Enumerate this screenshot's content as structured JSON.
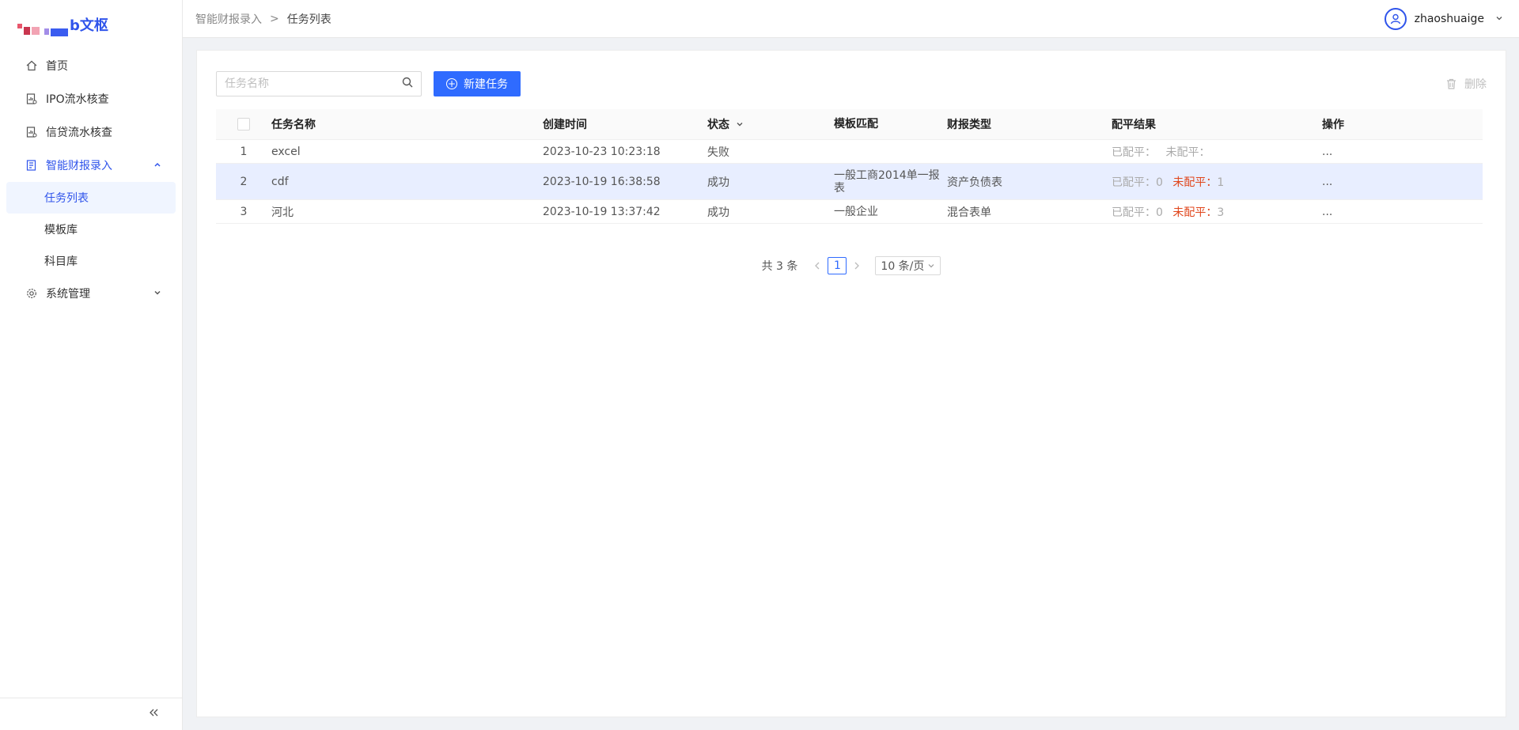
{
  "sidebar": {
    "logo_text": "b文枢",
    "menu": [
      {
        "label": "首页",
        "icon": "home-icon"
      },
      {
        "label": "IPO流水核查",
        "icon": "document-chart-icon"
      },
      {
        "label": "信贷流水核查",
        "icon": "document-chart-icon"
      },
      {
        "label": "智能财报录入",
        "icon": "report-icon"
      },
      {
        "label": "系统管理",
        "icon": "gear-icon"
      }
    ],
    "submenu": [
      "任务列表",
      "模板库",
      "科目库"
    ],
    "collapse_icon": "double-chevron-left-icon"
  },
  "header": {
    "breadcrumb": [
      "智能财报录入",
      "任务列表"
    ],
    "breadcrumb_separator": ">",
    "username": "zhaoshuaige"
  },
  "toolbar": {
    "search_placeholder": "任务名称",
    "new_task_label": "新建任务",
    "delete_label": "删除"
  },
  "table": {
    "columns": [
      "任务名称",
      "创建时间",
      "状态",
      "模板匹配",
      "财报类型",
      "配平结果",
      "操作"
    ],
    "rows": [
      {
        "index": "1",
        "name": "excel",
        "created": "2023-10-23 10:23:18",
        "status": "失败",
        "template": "",
        "type": "",
        "balanced_label": "已配平：",
        "balanced": "",
        "unbalanced_label": "未配平：",
        "unbalanced": "",
        "op": "..."
      },
      {
        "index": "2",
        "name": "cdf",
        "created": "2023-10-19 16:38:58",
        "status": "成功",
        "template": "一般工商2014单一报表",
        "type": "资产负债表",
        "balanced_label": "已配平：",
        "balanced": "0",
        "unbalanced_label": "未配平：",
        "unbalanced": "1",
        "op": "..."
      },
      {
        "index": "3",
        "name": "河北",
        "created": "2023-10-19 13:37:42",
        "status": "成功",
        "template": "一般企业",
        "type": "混合表单",
        "balanced_label": "已配平：",
        "balanced": "0",
        "unbalanced_label": "未配平：",
        "unbalanced": "3",
        "op": "..."
      }
    ]
  },
  "pagination": {
    "total_text": "共 3 条",
    "current_page": "1",
    "page_size": "10 条/页"
  },
  "colors": {
    "accent": "#2f6bff",
    "danger": "#e0461c",
    "selected_row": "#e8eeff"
  }
}
